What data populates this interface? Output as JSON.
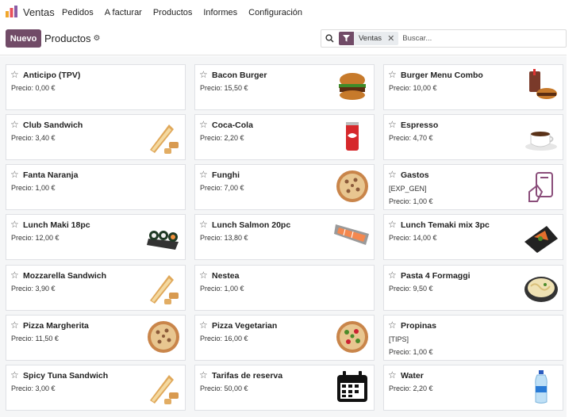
{
  "app": {
    "name": "Ventas",
    "menu": [
      "Pedidos",
      "A facturar",
      "Productos",
      "Informes",
      "Configuración"
    ]
  },
  "control": {
    "new_label": "Nuevo",
    "breadcrumb": "Productos"
  },
  "search": {
    "facet_label": "Ventas",
    "placeholder": "Buscar..."
  },
  "colors": {
    "brand": "#714b67"
  },
  "products": [
    {
      "name": "Anticipo (TPV)",
      "price": "Precio: 0,00 €",
      "code": "",
      "image": "none"
    },
    {
      "name": "Bacon Burger",
      "price": "Precio: 15,50 €",
      "code": "",
      "image": "burger-icon"
    },
    {
      "name": "Burger Menu Combo",
      "price": "Precio: 10,00 €",
      "code": "",
      "image": "combo-icon"
    },
    {
      "name": "Club Sandwich",
      "price": "Precio: 3,40 €",
      "code": "",
      "image": "sandwich-icon"
    },
    {
      "name": "Coca-Cola",
      "price": "Precio: 2,20 €",
      "code": "",
      "image": "can-icon"
    },
    {
      "name": "Espresso",
      "price": "Precio: 4,70 €",
      "code": "",
      "image": "coffee-icon"
    },
    {
      "name": "Fanta Naranja",
      "price": "Precio: 1,00 €",
      "code": "",
      "image": "none"
    },
    {
      "name": "Funghi",
      "price": "Precio: 7,00 €",
      "code": "",
      "image": "pizza-icon"
    },
    {
      "name": "Gastos",
      "price": "Precio: 1,00 €",
      "code": "[EXP_GEN]",
      "image": "expense-icon"
    },
    {
      "name": "Lunch Maki 18pc",
      "price": "Precio: 12,00 €",
      "code": "",
      "image": "maki-icon"
    },
    {
      "name": "Lunch Salmon 20pc",
      "price": "Precio: 13,80 €",
      "code": "",
      "image": "salmon-icon"
    },
    {
      "name": "Lunch Temaki mix 3pc",
      "price": "Precio: 14,00 €",
      "code": "",
      "image": "temaki-icon"
    },
    {
      "name": "Mozzarella Sandwich",
      "price": "Precio: 3,90 €",
      "code": "",
      "image": "sandwich-icon"
    },
    {
      "name": "Nestea",
      "price": "Precio: 1,00 €",
      "code": "",
      "image": "none"
    },
    {
      "name": "Pasta 4 Formaggi",
      "price": "Precio: 9,50 €",
      "code": "",
      "image": "pasta-icon"
    },
    {
      "name": "Pizza Margherita",
      "price": "Precio: 11,50 €",
      "code": "",
      "image": "pizza-icon"
    },
    {
      "name": "Pizza Vegetarian",
      "price": "Precio: 16,00 €",
      "code": "",
      "image": "pizza-veg-icon"
    },
    {
      "name": "Propinas",
      "price": "Precio: 1,00 €",
      "code": "[TIPS]",
      "image": "none"
    },
    {
      "name": "Spicy Tuna Sandwich",
      "price": "Precio: 3,00 €",
      "code": "",
      "image": "sandwich-icon"
    },
    {
      "name": "Tarifas de reserva",
      "price": "Precio: 50,00 €",
      "code": "",
      "image": "calendar-icon"
    },
    {
      "name": "Water",
      "price": "Precio: 2,20 €",
      "code": "",
      "image": "bottle-icon"
    }
  ]
}
